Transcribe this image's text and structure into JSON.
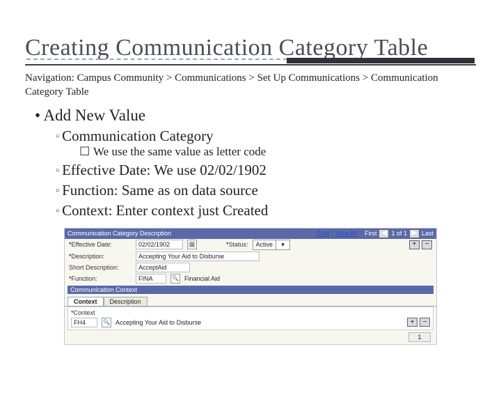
{
  "title": "Creating Communication Category Table",
  "nav": "Navigation: Campus Community > Communications  > Set Up Communications > Communication Category Table",
  "bullets": {
    "lvl1": "Add New Value",
    "lvl2_1": "Communication Category",
    "lvl3_1": "We use the same value as letter code",
    "lvl2_2_label": "Effective Date:",
    "lvl2_2_value": " We use 02/02/1902",
    "lvl2_3_label": "Function:",
    "lvl2_3_value": " Same as on data source",
    "lvl2_4_label": "Context:",
    "lvl2_4_value": " Enter context just Created"
  },
  "form": {
    "header": "Communication Category Description",
    "navbar": {
      "find": "Find",
      "viewall": "View All",
      "first": "First",
      "count": "1 of 1",
      "last": "Last"
    },
    "effdate_label": "Effective Date:",
    "effdate_value": "02/02/1902",
    "status_label": "Status:",
    "status_value": "Active",
    "desc_label": "Description:",
    "desc_value": "Accepting Your Aid to Disburse",
    "shortdesc_label": "Short Description:",
    "shortdesc_value": "AcceptAid",
    "function_label": "Function:",
    "function_value": "FINA",
    "function_text": "Financial Aid",
    "ctx_header": "Communication Context",
    "tabs": {
      "context": "Context",
      "description": "Description"
    },
    "ctx_label": "Context",
    "ctx_value": "FH4",
    "ctx_desc": "Accepting Your Aid to Disburse",
    "footer_count": "1"
  }
}
